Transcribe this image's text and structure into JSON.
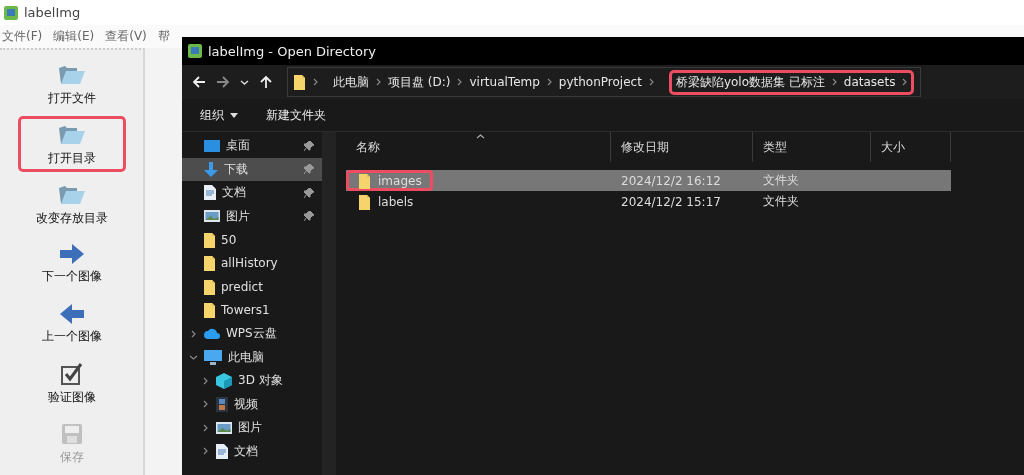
{
  "window": {
    "title": "labelImg"
  },
  "menu": [
    "文件(F)",
    "编辑(E)",
    "查看(V)",
    "帮"
  ],
  "toolbar": [
    {
      "label": "打开文件",
      "kind": "folder",
      "disabled": false,
      "highlighted": false
    },
    {
      "label": "打开目录",
      "kind": "folder",
      "disabled": false,
      "highlighted": true
    },
    {
      "label": "改变存放目录",
      "kind": "folder",
      "disabled": false,
      "highlighted": false
    },
    {
      "label": "下一个图像",
      "kind": "next",
      "disabled": false,
      "highlighted": false
    },
    {
      "label": "上一个图像",
      "kind": "prev",
      "disabled": false,
      "highlighted": false
    },
    {
      "label": "验证图像",
      "kind": "check",
      "disabled": false,
      "highlighted": false
    },
    {
      "label": "保存",
      "kind": "save",
      "disabled": true,
      "highlighted": false
    }
  ],
  "dialog": {
    "title": "labelImg - Open Directory",
    "breadcrumb_groups": [
      {
        "labels": [
          "此电脑",
          "项目盘 (D:)",
          "virtualTemp",
          "pythonProject"
        ],
        "highlighted": false
      },
      {
        "labels": [
          "桥梁缺陷yolo数据集 已标注",
          "datasets"
        ],
        "highlighted": true
      }
    ],
    "commands": [
      {
        "label": "组织",
        "dropdown": true
      },
      {
        "label": "新建文件夹",
        "dropdown": false
      }
    ],
    "nav": [
      {
        "label": "桌面",
        "kind": "desktop",
        "pinned": true,
        "selected": false
      },
      {
        "label": "下载",
        "kind": "download",
        "pinned": true,
        "selected": true
      },
      {
        "label": "文档",
        "kind": "doc",
        "pinned": true,
        "selected": false
      },
      {
        "label": "图片",
        "kind": "image",
        "pinned": true,
        "selected": false
      },
      {
        "label": "50",
        "kind": "folder",
        "pinned": false,
        "selected": false
      },
      {
        "label": "allHistory",
        "kind": "folder",
        "pinned": false,
        "selected": false
      },
      {
        "label": "predict",
        "kind": "folder",
        "pinned": false,
        "selected": false
      },
      {
        "label": "Towers1",
        "kind": "folder",
        "pinned": false,
        "selected": false
      },
      {
        "label": "WPS云盘",
        "kind": "cloud",
        "pinned": false,
        "selected": false,
        "expanded": false
      },
      {
        "label": "此电脑",
        "kind": "pc",
        "pinned": false,
        "selected": false,
        "expanded": true,
        "children": [
          {
            "label": "3D 对象",
            "kind": "cube",
            "pinned": false,
            "selected": false,
            "expanded": false
          },
          {
            "label": "视频",
            "kind": "video",
            "pinned": false,
            "selected": false,
            "expanded": false
          },
          {
            "label": "图片",
            "kind": "image",
            "pinned": false,
            "selected": false,
            "expanded": false
          },
          {
            "label": "文档",
            "kind": "doc",
            "pinned": false,
            "selected": false,
            "expanded": false
          }
        ]
      }
    ],
    "columns": [
      "名称",
      "修改日期",
      "类型",
      "大小"
    ],
    "rows": [
      {
        "name": "images",
        "date": "2024/12/2 16:12",
        "type": "文件夹",
        "selected": true,
        "highlighted": true
      },
      {
        "name": "labels",
        "date": "2024/12/2 15:17",
        "type": "文件夹",
        "selected": false,
        "highlighted": false
      }
    ]
  }
}
